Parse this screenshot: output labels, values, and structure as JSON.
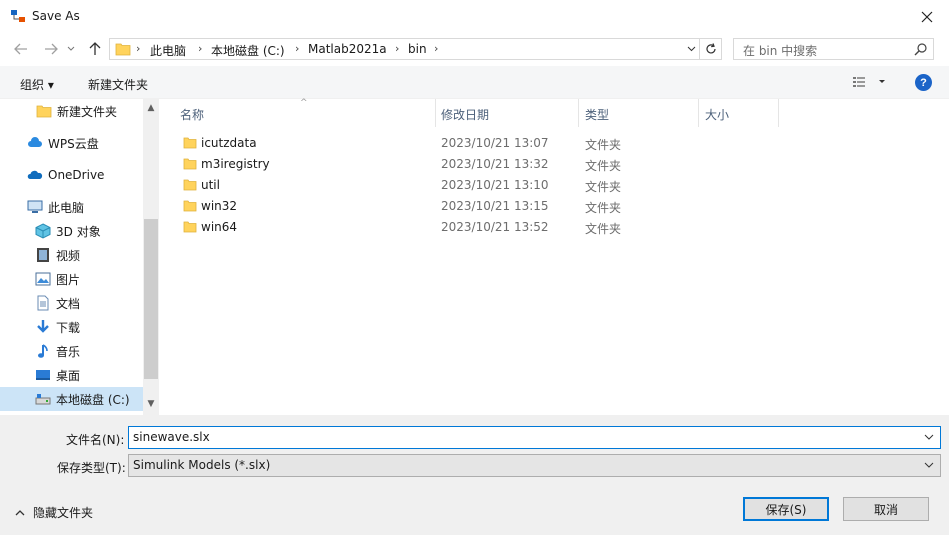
{
  "window": {
    "title": "Save As"
  },
  "address": {
    "crumbs": [
      "此电脑",
      "本地磁盘 (C:)",
      "Matlab2021a",
      "bin"
    ]
  },
  "search": {
    "placeholder": "在 bin 中搜索"
  },
  "toolbar": {
    "organize_label": "组织 ▾",
    "new_folder_label": "新建文件夹"
  },
  "nav": {
    "items": [
      {
        "label": "新建文件夹",
        "icon": "folder-icon"
      },
      {
        "label": "WPS云盘",
        "icon": "cloud-icon"
      },
      {
        "label": "OneDrive",
        "icon": "onedrive-icon"
      },
      {
        "label": "此电脑",
        "icon": "computer-icon"
      },
      {
        "label": "3D 对象",
        "icon": "3d-objects-icon"
      },
      {
        "label": "视频",
        "icon": "video-icon"
      },
      {
        "label": "图片",
        "icon": "pictures-icon"
      },
      {
        "label": "文档",
        "icon": "documents-icon"
      },
      {
        "label": "下载",
        "icon": "download-icon"
      },
      {
        "label": "音乐",
        "icon": "music-icon"
      },
      {
        "label": "桌面",
        "icon": "desktop-icon"
      },
      {
        "label": "本地磁盘 (C:)",
        "icon": "drive-icon",
        "selected": true
      }
    ]
  },
  "list": {
    "columns": [
      "名称",
      "修改日期",
      "类型",
      "大小"
    ],
    "rows": [
      {
        "name": "icutzdata",
        "date": "2023/10/21 13:07",
        "type": "文件夹"
      },
      {
        "name": "m3iregistry",
        "date": "2023/10/21 13:32",
        "type": "文件夹"
      },
      {
        "name": "util",
        "date": "2023/10/21 13:10",
        "type": "文件夹"
      },
      {
        "name": "win32",
        "date": "2023/10/21 13:15",
        "type": "文件夹"
      },
      {
        "name": "win64",
        "date": "2023/10/21 13:52",
        "type": "文件夹"
      }
    ]
  },
  "form": {
    "filename_label": "文件名(N):",
    "filename_value": "sinewave.slx",
    "filetype_label": "保存类型(T):",
    "filetype_value": "Simulink Models (*.slx)"
  },
  "footer": {
    "hide_folders_label": "隐藏文件夹",
    "save_label": "保存(S)",
    "cancel_label": "取消"
  },
  "colors": {
    "accent": "#0078d7",
    "folder": "#ffd35c",
    "selected": "#cce4f7"
  }
}
